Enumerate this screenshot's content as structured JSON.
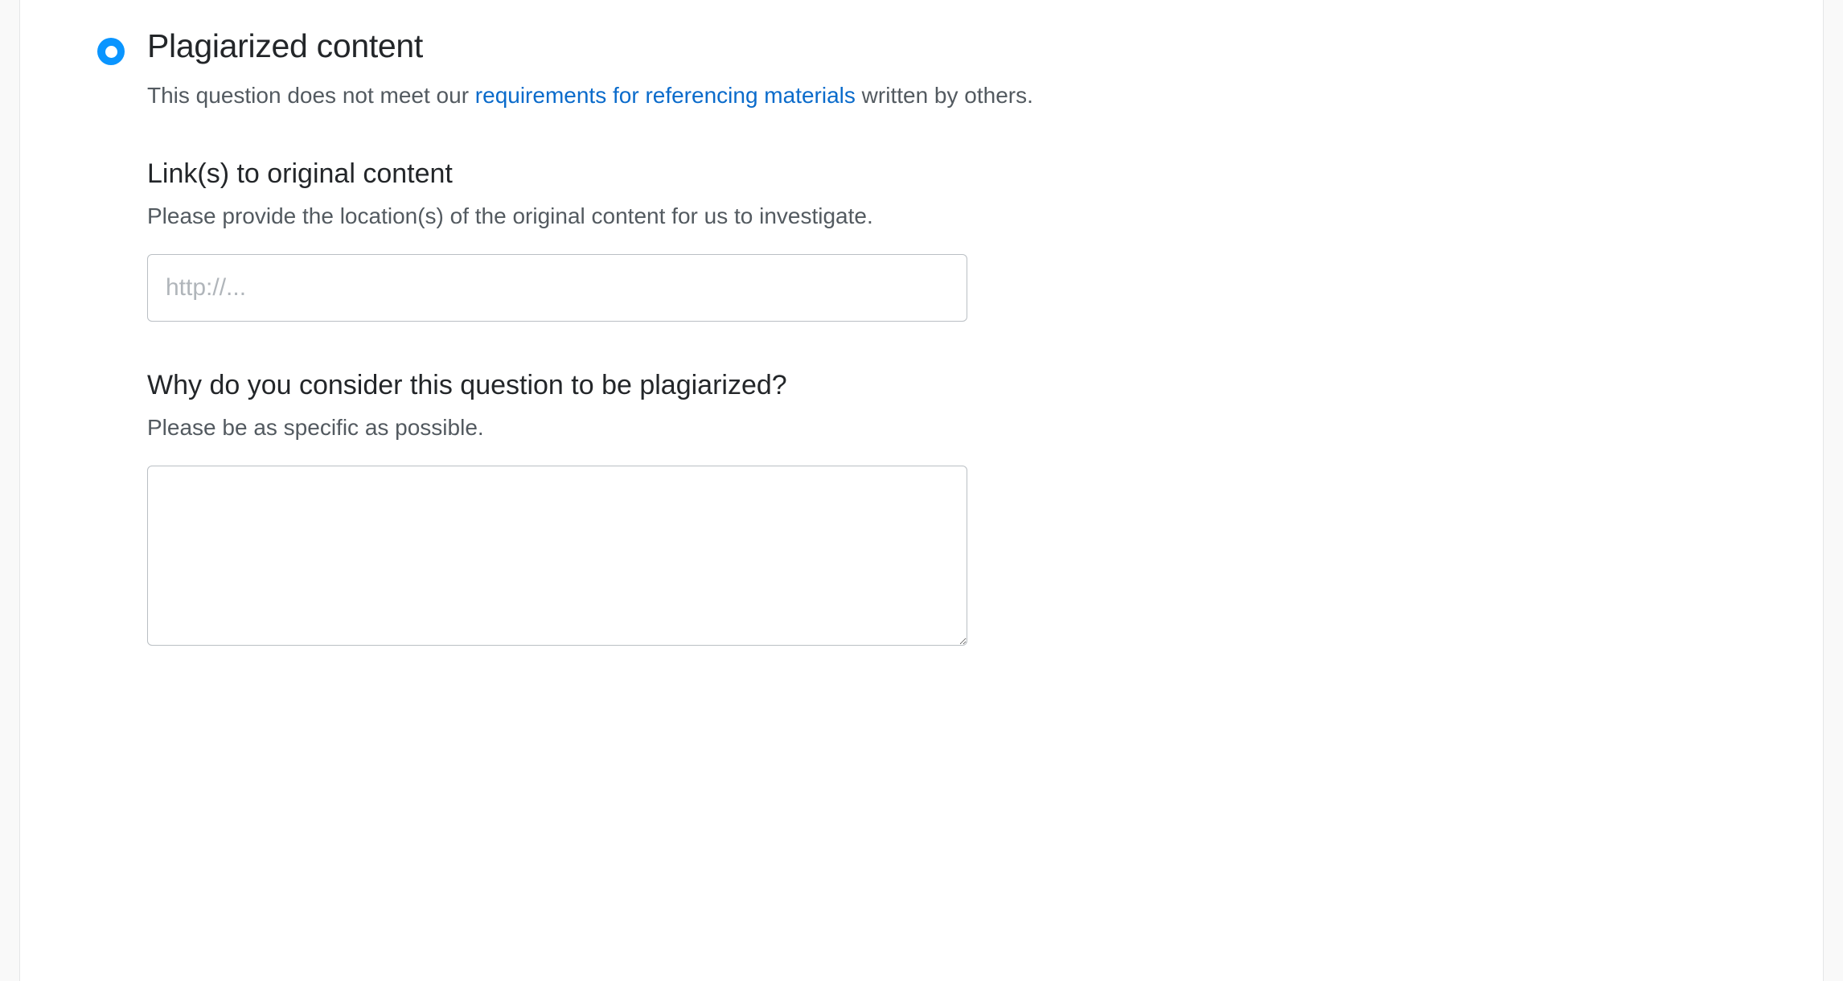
{
  "flag": {
    "plagiarized": {
      "title": "Plagiarized content",
      "description_prefix": "This question does not meet our ",
      "description_link": "requirements for referencing materials",
      "description_suffix": " written by others.",
      "links": {
        "heading": "Link(s) to original content",
        "help": "Please provide the location(s) of the original content for us to investigate.",
        "placeholder": "http://..."
      },
      "reason": {
        "heading": "Why do you consider this question to be plagiarized?",
        "help": "Please be as specific as possible."
      }
    }
  }
}
